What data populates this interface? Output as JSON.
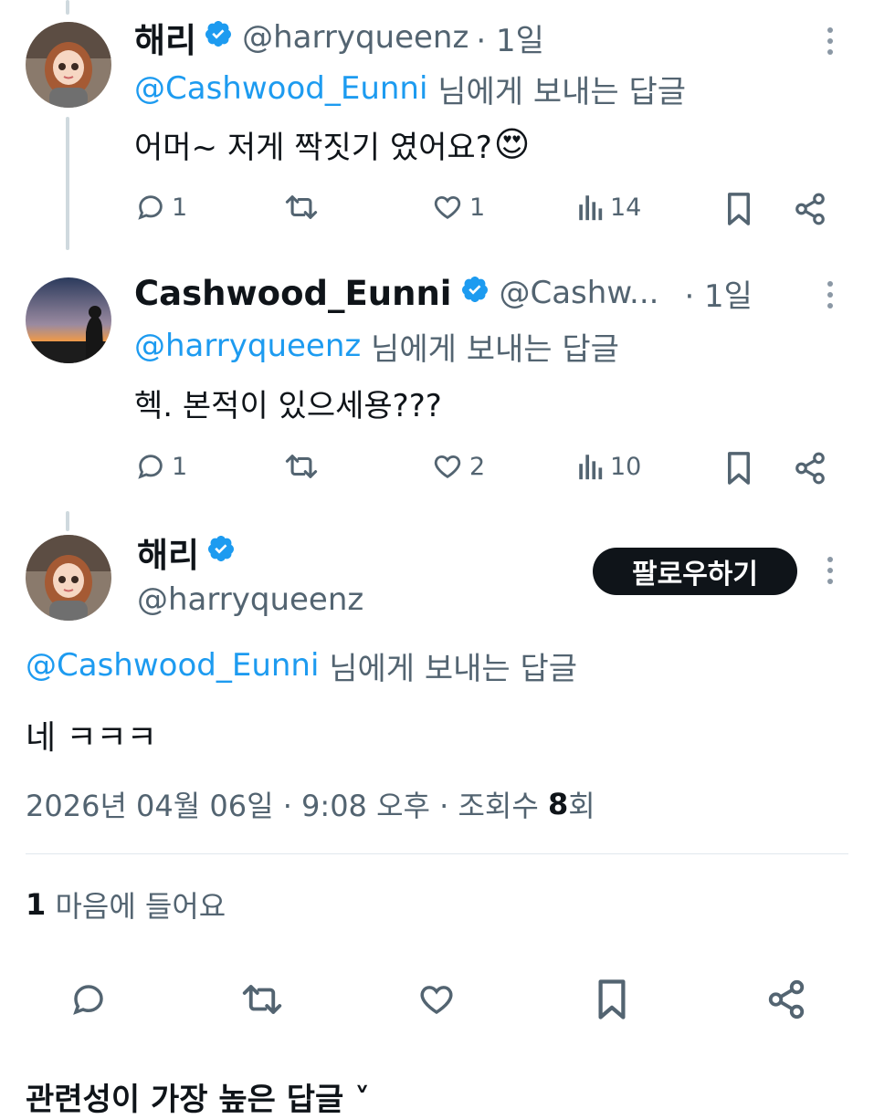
{
  "tweets": [
    {
      "name": "해리",
      "handle": "@harryqueenz",
      "time": "· 1일",
      "reply_mention": "@Cashwood_Eunni",
      "reply_suffix": " 님에게 보내는 답글",
      "text": "어머~ 저게 짝짓기 였어요?",
      "emoji": "😍",
      "replies": "1",
      "retweets": "",
      "likes": "1",
      "views": "14"
    },
    {
      "name": "Cashwood_Eunni",
      "handle": "@Cashw...",
      "time": "· 1일",
      "reply_mention": "@harryqueenz",
      "reply_suffix": " 님에게 보내는 답글",
      "text": "헥. 본적이 있으세용???",
      "replies": "1",
      "retweets": "",
      "likes": "2",
      "views": "10"
    }
  ],
  "main_tweet": {
    "name": "해리",
    "handle": "@harryqueenz",
    "follow_label": "팔로우하기",
    "reply_mention": "@Cashwood_Eunni",
    "reply_suffix": " 님에게 보내는 답글",
    "text": "네 ㅋㅋㅋ",
    "timestamp": "2026년 04월 06일 · 9:08 오후 · 조회수 ",
    "view_count": "8",
    "view_unit": "회",
    "likes_count": "1",
    "likes_label": " 마음에 들어요"
  },
  "section_header": "관련성이 가장 높은 답글 ˅",
  "colors": {
    "accent": "#1d9bf0",
    "muted": "#536471",
    "text": "#0f1419",
    "follow_bg": "#0f1419"
  }
}
